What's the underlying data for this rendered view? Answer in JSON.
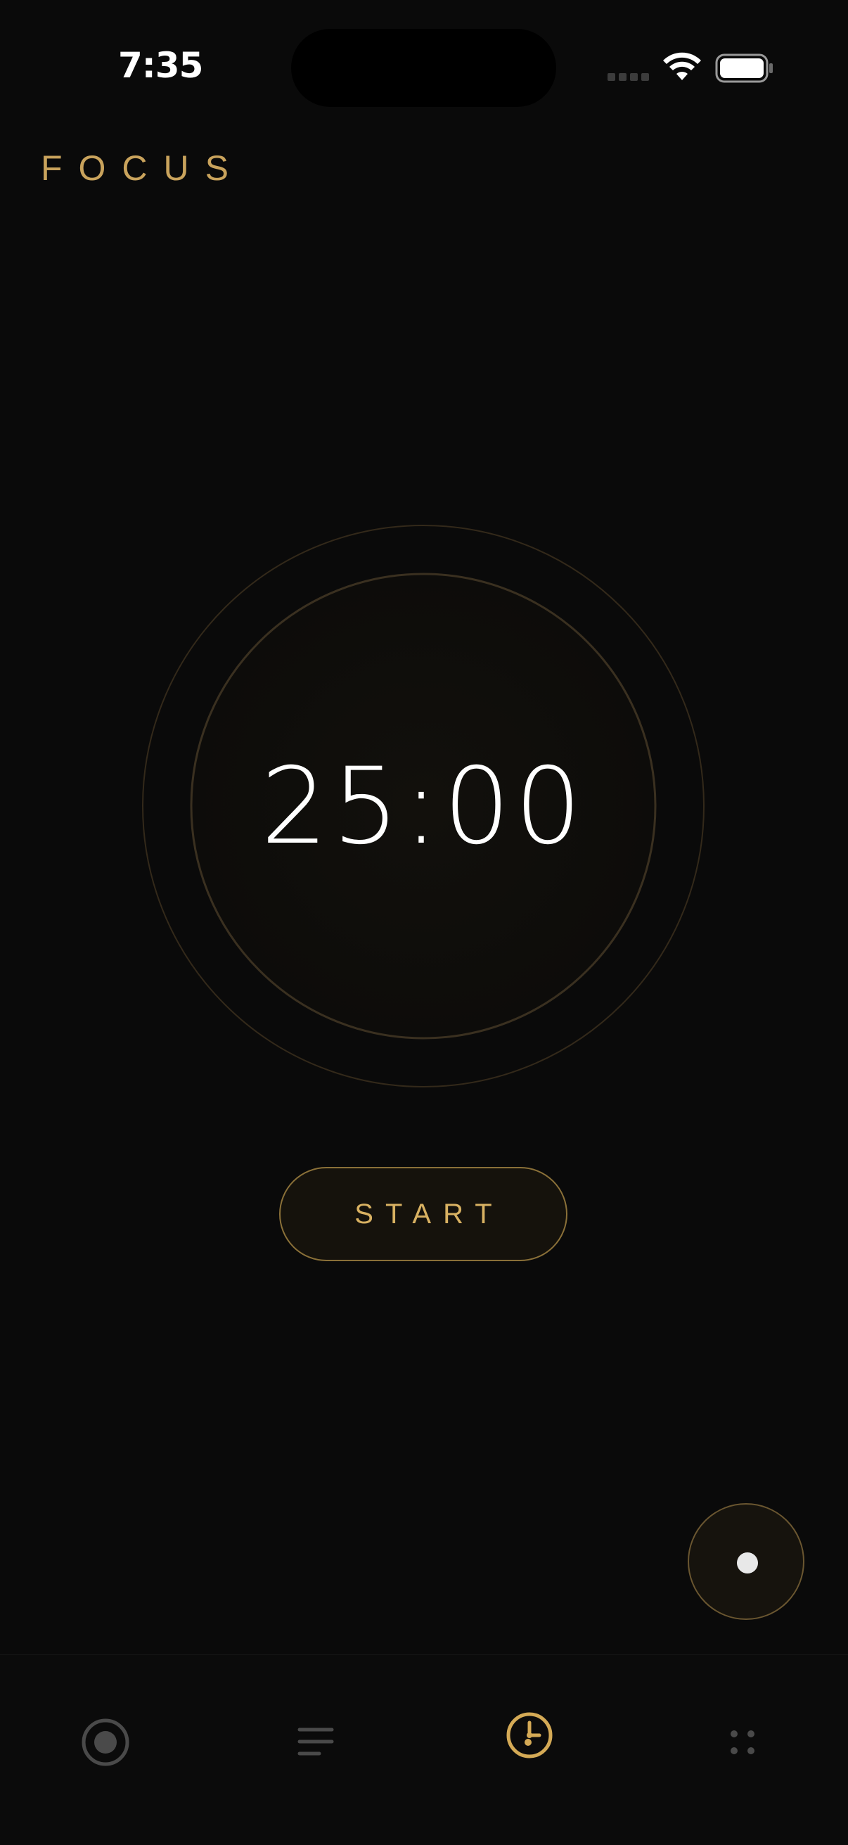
{
  "status_bar": {
    "time": "7:35",
    "icons": [
      "signal-icon",
      "wifi-icon",
      "battery-icon"
    ]
  },
  "header": {
    "title": "FOCUS"
  },
  "timer": {
    "display": "25:00"
  },
  "controls": {
    "start_label": "START",
    "fab_icon": "record-dot-icon"
  },
  "tab_bar": {
    "tabs": [
      {
        "icon": "record-icon",
        "active": false
      },
      {
        "icon": "list-icon",
        "active": false
      },
      {
        "icon": "clock-icon",
        "active": true
      },
      {
        "icon": "grid-dots-icon",
        "active": false
      }
    ]
  },
  "colors": {
    "background": "#0a0a0a",
    "accent": "#c9a35c",
    "ring": "#3a3020",
    "inactive_icon": "#4a4a4a"
  }
}
